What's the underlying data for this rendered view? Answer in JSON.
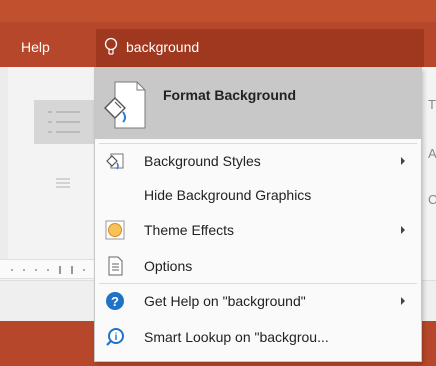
{
  "titlebar": {
    "help_label": "Help"
  },
  "search": {
    "value": "background"
  },
  "ribbon": {
    "right_letters": [
      "T",
      "A",
      "C"
    ]
  },
  "menu": {
    "top_item": {
      "label": "Format Background"
    },
    "items": [
      {
        "label": "Background Styles",
        "icon": "background-styles-icon",
        "submenu": true
      },
      {
        "label": "Hide Background Graphics",
        "icon": "",
        "submenu": false
      },
      {
        "label": "Theme Effects",
        "icon": "theme-effects-icon",
        "submenu": true
      },
      {
        "label": "Options",
        "icon": "options-icon",
        "submenu": false
      },
      {
        "label": "Get Help on \"background\"",
        "icon": "help-icon",
        "submenu": true
      },
      {
        "label": "Smart Lookup on \"backgrou...",
        "icon": "smart-lookup-icon",
        "submenu": false
      }
    ]
  },
  "colors": {
    "brand": "#b7472a",
    "search_bg": "#a0371f",
    "highlight": "#c8c8c8",
    "help_blue": "#1e73c8"
  }
}
